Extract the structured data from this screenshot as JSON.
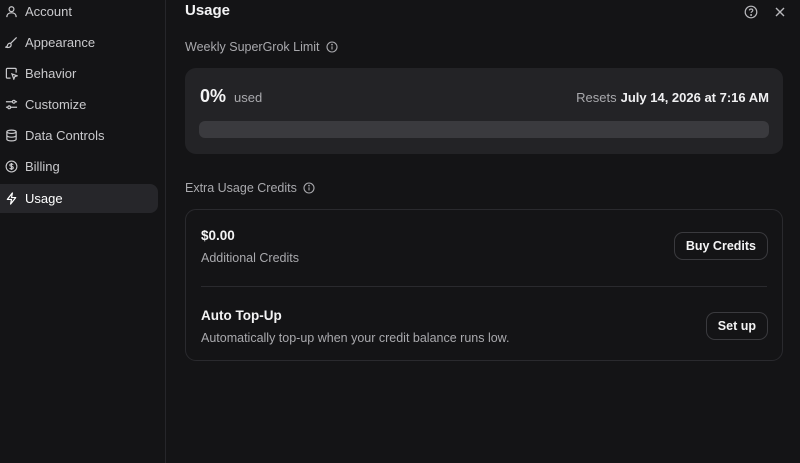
{
  "sidebar": {
    "items": [
      {
        "label": "Account",
        "icon": "user-icon"
      },
      {
        "label": "Appearance",
        "icon": "brush-icon"
      },
      {
        "label": "Behavior",
        "icon": "cursor-window-icon"
      },
      {
        "label": "Customize",
        "icon": "sliders-icon"
      },
      {
        "label": "Data Controls",
        "icon": "database-icon"
      },
      {
        "label": "Billing",
        "icon": "dollar-circle-icon"
      },
      {
        "label": "Usage",
        "icon": "bolt-icon",
        "active": true
      }
    ]
  },
  "header": {
    "title": "Usage",
    "help_icon": "help-circle-icon",
    "close_icon": "close-icon"
  },
  "weekly_limit": {
    "label": "Weekly SuperGrok Limit",
    "percent_text": "0%",
    "used_label": "used",
    "resets_label": "Resets",
    "resets_date": "July 14, 2026 at 7:16 AM",
    "progress_fraction": 0
  },
  "extra_credits": {
    "label": "Extra Usage Credits",
    "amount": "$0.00",
    "amount_caption": "Additional Credits",
    "buy_button": "Buy Credits",
    "auto_topup_title": "Auto Top-Up",
    "auto_topup_desc": "Automatically top-up when your credit balance runs low.",
    "setup_button": "Set up"
  },
  "colors": {
    "background": "#141416",
    "card": "#232326",
    "active_item": "#26262a",
    "text": "#f4f4f5",
    "muted": "#a9a9ad"
  }
}
